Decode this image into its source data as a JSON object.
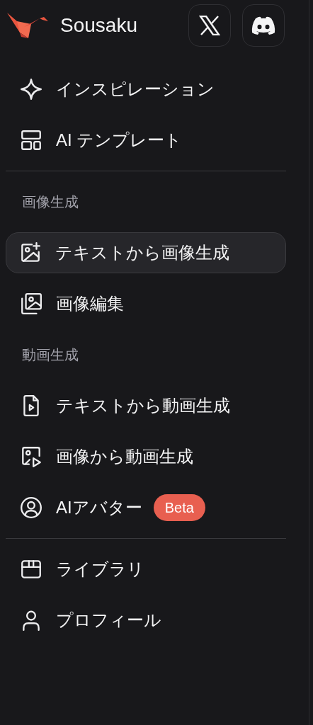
{
  "brand": {
    "name": "Sousaku"
  },
  "groups": [
    {
      "sections": [
        {
          "items": [
            {
              "label": "インスピレーション",
              "selected": false
            },
            {
              "label": "AI テンプレート",
              "selected": false
            }
          ]
        }
      ]
    },
    {
      "sections": [
        {
          "heading": "画像生成",
          "items": [
            {
              "label": "テキストから画像生成",
              "selected": true
            },
            {
              "label": "画像編集",
              "selected": false
            }
          ]
        },
        {
          "heading": "動画生成",
          "items": [
            {
              "label": "テキストから動画生成",
              "selected": false
            },
            {
              "label": "画像から動画生成",
              "selected": false
            },
            {
              "label": "AIアバター",
              "selected": false,
              "badge": "Beta"
            }
          ]
        }
      ]
    },
    {
      "sections": [
        {
          "items": [
            {
              "label": "ライブラリ",
              "selected": false
            },
            {
              "label": "プロフィール",
              "selected": false
            }
          ]
        }
      ]
    }
  ]
}
